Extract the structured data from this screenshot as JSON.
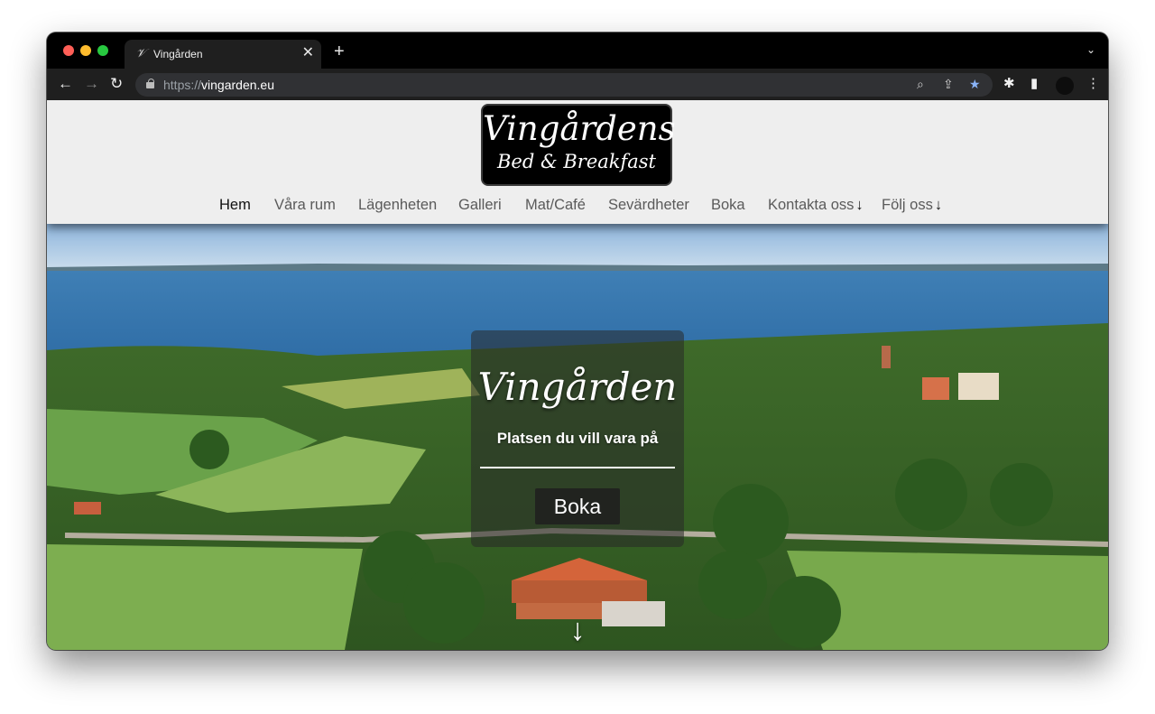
{
  "browser": {
    "tab_title": "Vingården",
    "tab_favicon": "𝒱",
    "close_glyph": "✕",
    "newtab_glyph": "+",
    "menu_glyph": "⌄",
    "url_scheme": "https://",
    "url_host": "vingarden.eu",
    "back_glyph": "←",
    "forward_glyph": "→",
    "reload_glyph": "↻",
    "zoom_glyph": "⌕",
    "share_glyph": "⇪",
    "bookmark_glyph": "★",
    "extensions_glyph": "✱",
    "sidepanel_glyph": "▮",
    "kebab_glyph": "⋮",
    "bookmark_color": "#8ab4f8"
  },
  "site": {
    "logo_line1": "Vingårdens",
    "logo_line2": "Bed & Breakfast",
    "nav": [
      {
        "label": "Hem",
        "active": true
      },
      {
        "label": "Våra rum"
      },
      {
        "label": "Lägenheten"
      },
      {
        "label": "Galleri"
      },
      {
        "label": "Mat/Café"
      },
      {
        "label": "Sevärdheter"
      },
      {
        "label": "Boka"
      },
      {
        "label": "Kontakta oss",
        "dropdown": true
      },
      {
        "label": "Följ oss",
        "dropdown": true
      }
    ],
    "dropdown_glyph": "↓"
  },
  "hero": {
    "title": "Vingården",
    "subtitle": "Platsen du vill vara på",
    "button_label": "Boka",
    "scroll_glyph": "↓"
  }
}
